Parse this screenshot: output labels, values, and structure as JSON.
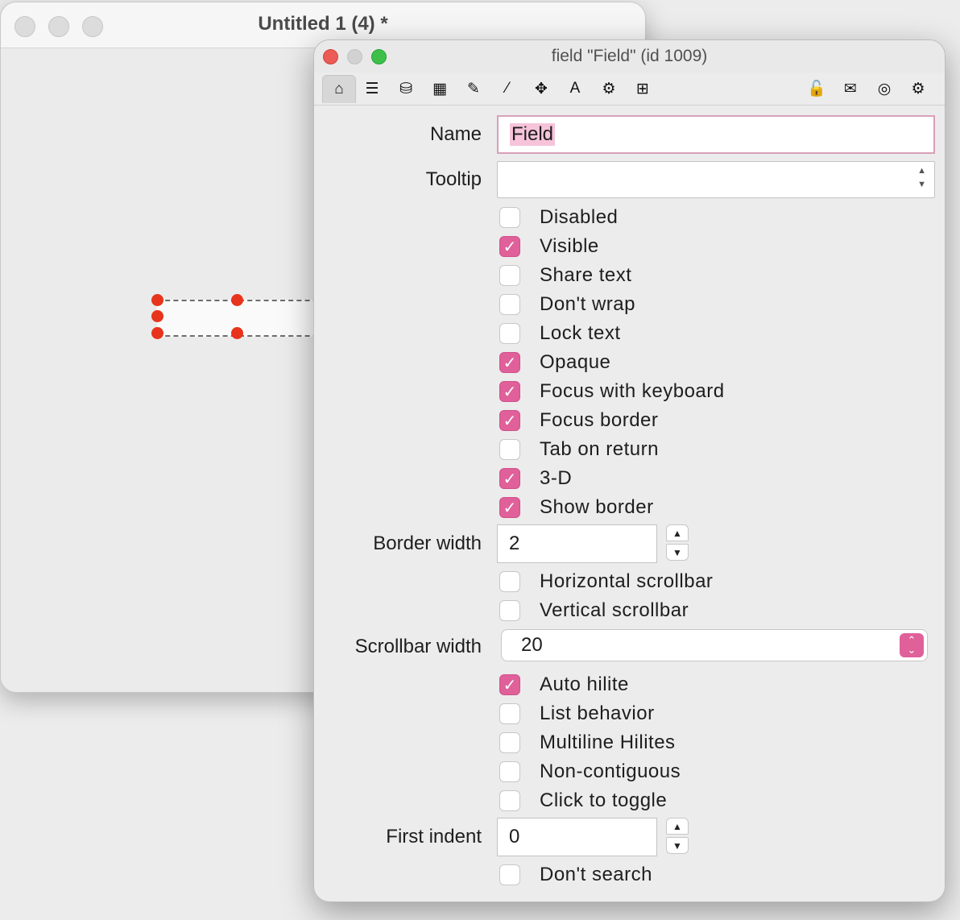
{
  "back_window": {
    "title": "Untitled 1 (4) *"
  },
  "inspector": {
    "title": "field \"Field\" (id 1009)",
    "toolbar_left": [
      {
        "icon": "home-icon",
        "glyph": "⌂",
        "active": true
      },
      {
        "icon": "list-icon",
        "glyph": "☰"
      },
      {
        "icon": "database-icon",
        "glyph": "⛁"
      },
      {
        "icon": "table-icon",
        "glyph": "▦"
      },
      {
        "icon": "pencil-icon",
        "glyph": "✎"
      },
      {
        "icon": "magic-wand-icon",
        "glyph": "⁄"
      },
      {
        "icon": "move-icon",
        "glyph": "✥"
      },
      {
        "icon": "text-icon",
        "glyph": "A"
      },
      {
        "icon": "gears-icon",
        "glyph": "⚙"
      },
      {
        "icon": "resize-icon",
        "glyph": "⊞"
      }
    ],
    "toolbar_right": [
      {
        "icon": "lock-icon",
        "glyph": "🔓"
      },
      {
        "icon": "script-icon",
        "glyph": "✉"
      },
      {
        "icon": "target-icon",
        "glyph": "◎"
      },
      {
        "icon": "settings-icon",
        "glyph": "⚙"
      }
    ],
    "name_label": "Name",
    "name_value": "Field",
    "tooltip_label": "Tooltip",
    "tooltip_value": "",
    "checks_a": [
      {
        "label": "Disabled",
        "checked": false
      },
      {
        "label": "Visible",
        "checked": true
      },
      {
        "label": "Share text",
        "checked": false
      },
      {
        "label": "Don't wrap",
        "checked": false
      },
      {
        "label": "Lock text",
        "checked": false
      },
      {
        "label": "Opaque",
        "checked": true
      },
      {
        "label": "Focus with keyboard",
        "checked": true
      },
      {
        "label": "Focus border",
        "checked": true
      },
      {
        "label": "Tab on return",
        "checked": false
      },
      {
        "label": "3-D",
        "checked": true
      },
      {
        "label": "Show border",
        "checked": true
      }
    ],
    "border_width_label": "Border width",
    "border_width_value": "2",
    "checks_b": [
      {
        "label": "Horizontal scrollbar",
        "checked": false
      },
      {
        "label": "Vertical scrollbar",
        "checked": false
      }
    ],
    "scrollbar_width_label": "Scrollbar width",
    "scrollbar_width_value": "20",
    "checks_c": [
      {
        "label": "Auto hilite",
        "checked": true
      },
      {
        "label": "List behavior",
        "checked": false
      },
      {
        "label": "Multiline Hilites",
        "checked": false
      },
      {
        "label": "Non-contiguous",
        "checked": false
      },
      {
        "label": "Click to toggle",
        "checked": false
      }
    ],
    "first_indent_label": "First indent",
    "first_indent_value": "0",
    "checks_d": [
      {
        "label": "Don't search",
        "checked": false
      }
    ],
    "accent_color": "#e0609a"
  }
}
